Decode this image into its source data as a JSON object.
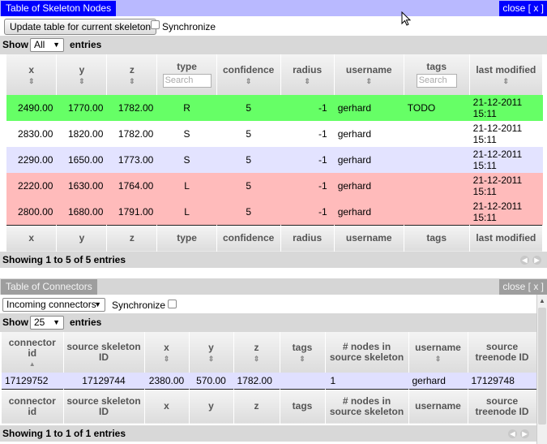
{
  "panel1": {
    "title": "Table of Skeleton Nodes",
    "close": "close [ x ]",
    "update_button": "Update table for current skeleton",
    "sync_label": "Synchronize",
    "show_label": "Show",
    "entries_label": "entries",
    "page_length": "All",
    "search_placeholder": "Search",
    "headers": [
      "x",
      "y",
      "z",
      "type",
      "confidence",
      "radius",
      "username",
      "tags",
      "last modified"
    ],
    "rows": [
      {
        "x": "2490.00",
        "y": "1770.00",
        "z": "1782.00",
        "type": "R",
        "confidence": "5",
        "radius": "-1",
        "username": "gerhard",
        "tags": "TODO",
        "modified_date": "21-12-2011",
        "modified_time": "15:11"
      },
      {
        "x": "2830.00",
        "y": "1820.00",
        "z": "1782.00",
        "type": "S",
        "confidence": "5",
        "radius": "-1",
        "username": "gerhard",
        "tags": "",
        "modified_date": "21-12-2011",
        "modified_time": "15:11"
      },
      {
        "x": "2290.00",
        "y": "1650.00",
        "z": "1773.00",
        "type": "S",
        "confidence": "5",
        "radius": "-1",
        "username": "gerhard",
        "tags": "",
        "modified_date": "21-12-2011",
        "modified_time": "15:11"
      },
      {
        "x": "2220.00",
        "y": "1630.00",
        "z": "1764.00",
        "type": "L",
        "confidence": "5",
        "radius": "-1",
        "username": "gerhard",
        "tags": "",
        "modified_date": "21-12-2011",
        "modified_time": "15:11"
      },
      {
        "x": "2800.00",
        "y": "1680.00",
        "z": "1791.00",
        "type": "L",
        "confidence": "5",
        "radius": "-1",
        "username": "gerhard",
        "tags": "",
        "modified_date": "21-12-2011",
        "modified_time": "15:11"
      }
    ],
    "info": "Showing 1 to 5 of 5 entries"
  },
  "panel2": {
    "title": "Table of Connectors",
    "close": "close [ x ]",
    "direction": "Incoming connectors",
    "sync_label": "Synchronize",
    "show_label": "Show",
    "entries_label": "entries",
    "page_length": "25",
    "headers": [
      "connector id",
      "source skeleton ID",
      "x",
      "y",
      "z",
      "tags",
      "# nodes in source skeleton",
      "username",
      "source treenode ID"
    ],
    "rows": [
      {
        "connector_id": "17129752",
        "source_skeleton": "17129744",
        "x": "2380.00",
        "y": "570.00",
        "z": "1782.00",
        "tags": "",
        "nodes": "1",
        "username": "gerhard",
        "treenode": "17129748"
      }
    ],
    "info": "Showing 1 to 1 of 1 entries"
  },
  "colors": {
    "active_title": "#0000ff",
    "row_root": "#66ff66",
    "row_leaf": "#ffbbbb",
    "row_alt": "#e3e3ff"
  },
  "icons": [
    "sort-icon",
    "sort-asc-icon",
    "dropdown-arrow-icon",
    "prev-page-icon",
    "next-page-icon",
    "mouse-cursor-icon"
  ]
}
